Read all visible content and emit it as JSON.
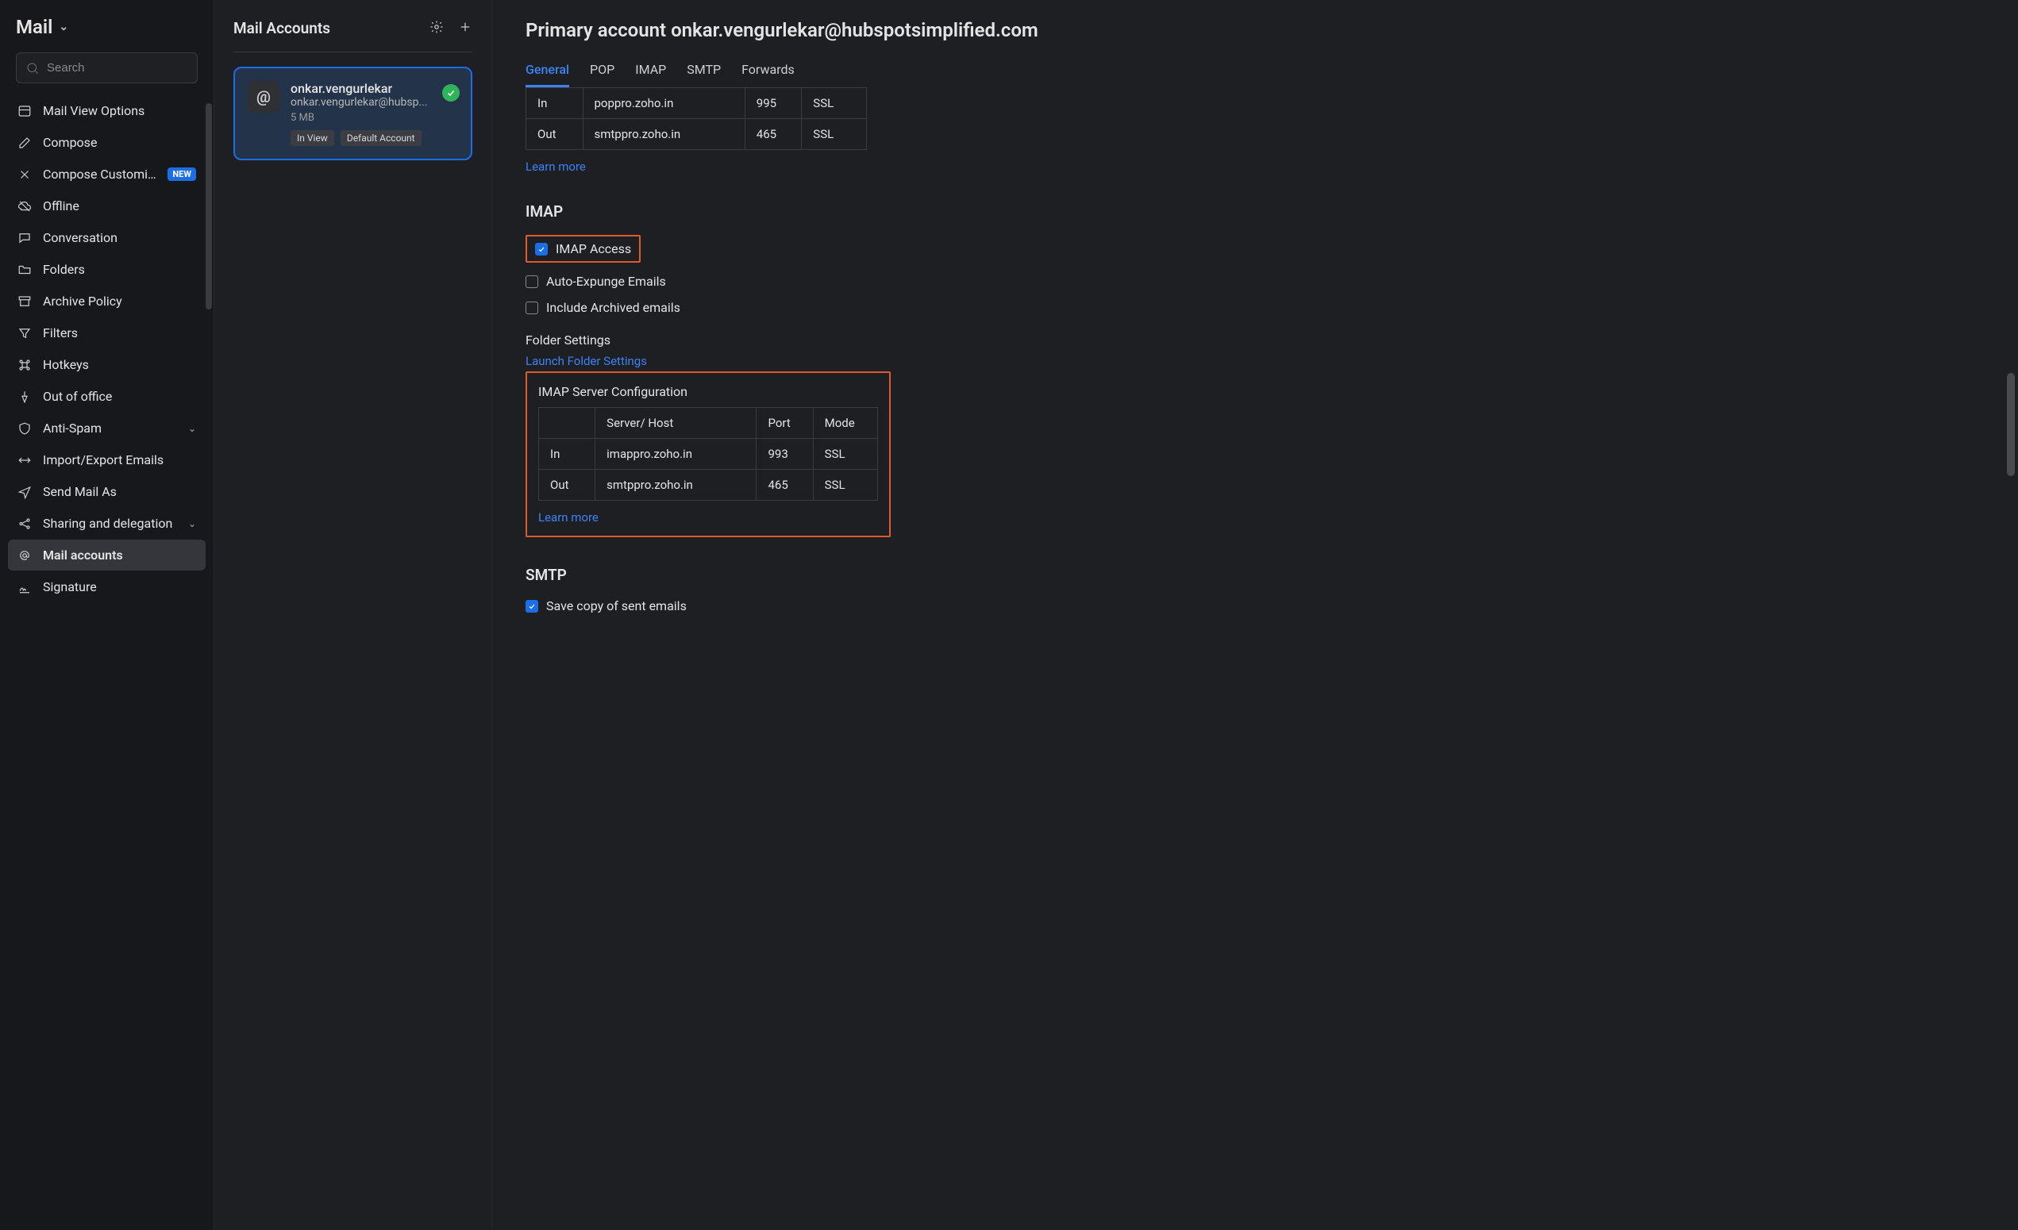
{
  "app": {
    "name": "Mail"
  },
  "search": {
    "placeholder": "Search"
  },
  "sidebar": {
    "items": [
      {
        "label": "Mail View Options",
        "icon": "layout-icon"
      },
      {
        "label": "Compose",
        "icon": "edit-icon"
      },
      {
        "label": "Compose Customi...",
        "icon": "tools-icon",
        "badge": "NEW"
      },
      {
        "label": "Offline",
        "icon": "cloud-off-icon"
      },
      {
        "label": "Conversation",
        "icon": "chat-icon"
      },
      {
        "label": "Folders",
        "icon": "folder-icon"
      },
      {
        "label": "Archive Policy",
        "icon": "archive-icon"
      },
      {
        "label": "Filters",
        "icon": "funnel-icon"
      },
      {
        "label": "Hotkeys",
        "icon": "command-icon"
      },
      {
        "label": "Out of office",
        "icon": "pin-icon"
      },
      {
        "label": "Anti-Spam",
        "icon": "shield-icon",
        "expandable": true
      },
      {
        "label": "Import/Export Emails",
        "icon": "swap-icon"
      },
      {
        "label": "Send Mail As",
        "icon": "send-icon"
      },
      {
        "label": "Sharing and delegation",
        "icon": "share-icon",
        "expandable": true
      },
      {
        "label": "Mail accounts",
        "icon": "at-icon",
        "active": true
      },
      {
        "label": "Signature",
        "icon": "signature-icon"
      }
    ]
  },
  "middle": {
    "title": "Mail Accounts",
    "account": {
      "name": "onkar.vengurlekar",
      "email": "onkar.vengurlekar@hubsp...",
      "size": "5 MB",
      "tags": [
        "In View",
        "Default Account"
      ]
    }
  },
  "main": {
    "title": "Primary account onkar.vengurlekar@hubspotsimplified.com",
    "tabs": [
      "General",
      "POP",
      "IMAP",
      "SMTP",
      "Forwards"
    ],
    "active_tab": "General",
    "pop_table": {
      "rows": [
        {
          "dir": "In",
          "host": "poppro.zoho.in",
          "port": "995",
          "mode": "SSL"
        },
        {
          "dir": "Out",
          "host": "smtppro.zoho.in",
          "port": "465",
          "mode": "SSL"
        }
      ]
    },
    "learn_more": "Learn more",
    "imap": {
      "heading": "IMAP",
      "access_label": "IMAP Access",
      "access_checked": true,
      "auto_expunge_label": "Auto-Expunge Emails",
      "auto_expunge_checked": false,
      "include_archived_label": "Include Archived emails",
      "include_archived_checked": false,
      "folder_settings_label": "Folder Settings",
      "launch_folder_settings": "Launch Folder Settings",
      "server_config_label": "IMAP Server Configuration",
      "headers": {
        "host": "Server/ Host",
        "port": "Port",
        "mode": "Mode"
      },
      "rows": [
        {
          "dir": "In",
          "host": "imappro.zoho.in",
          "port": "993",
          "mode": "SSL"
        },
        {
          "dir": "Out",
          "host": "smtppro.zoho.in",
          "port": "465",
          "mode": "SSL"
        }
      ]
    },
    "smtp": {
      "heading": "SMTP",
      "save_copy_label": "Save copy of sent emails",
      "save_copy_checked": true
    }
  }
}
